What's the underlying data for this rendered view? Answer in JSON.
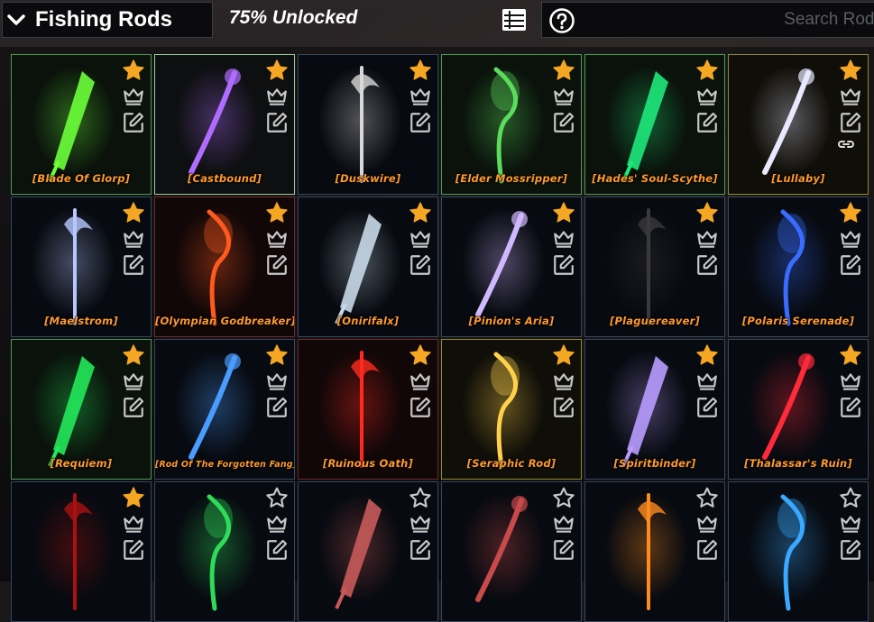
{
  "header": {
    "title": "Fishing Rods",
    "unlocked": "75% Unlocked",
    "search_placeholder": "Search Rods"
  },
  "colors": {
    "name_text": "#ff9a2e",
    "star_filled": "#f5a623",
    "icon_gray": "#c8c8c8"
  },
  "rods": [
    {
      "name": "[Blade Of Glorp]",
      "color": "#6cff3a",
      "favorited": true
    },
    {
      "name": "[Castbound]",
      "color": "#b06cff",
      "favorited": true
    },
    {
      "name": "[Duskwire]",
      "color": "#d8d8d8",
      "favorited": true
    },
    {
      "name": "[Elder Mossripper]",
      "color": "#5cdc5c",
      "favorited": true
    },
    {
      "name": "[Hades' Soul-Scythe]",
      "color": "#1ee87a",
      "favorited": true
    },
    {
      "name": "[Lullaby]",
      "color": "#e8e8ff",
      "favorited": true
    },
    {
      "name": "[Maelstrom]",
      "color": "#b8c8ff",
      "favorited": true
    },
    {
      "name": "[Olympian Godbreaker]",
      "color": "#ff5a1e",
      "favorited": true
    },
    {
      "name": "[Onirifalx]",
      "color": "#c8d8e8",
      "favorited": true
    },
    {
      "name": "[Pinion's Aria]",
      "color": "#d0b8ff",
      "favorited": true
    },
    {
      "name": "[Plaguereaver]",
      "color": "#3a3a3a",
      "favorited": true
    },
    {
      "name": "[Polaris Serenade]",
      "color": "#3a6cff",
      "favorited": true
    },
    {
      "name": "[Requiem]",
      "color": "#22e85a",
      "favorited": true
    },
    {
      "name": "[Rod Of The Forgotten Fang]",
      "color": "#4a9cff",
      "favorited": true
    },
    {
      "name": "[Ruinous Oath]",
      "color": "#ff2a1e",
      "favorited": true
    },
    {
      "name": "[Seraphic Rod]",
      "color": "#ffd04a",
      "favorited": true
    },
    {
      "name": "[Spiritbinder]",
      "color": "#b89cff",
      "favorited": true
    },
    {
      "name": "[Thalassar's Ruin]",
      "color": "#ff2a3a",
      "favorited": true
    },
    {
      "name": "",
      "color": "#aa1111",
      "favorited": true
    },
    {
      "name": "",
      "color": "#2edc5a",
      "favorited": false
    },
    {
      "name": "",
      "color": "#c85a5a",
      "favorited": false
    },
    {
      "name": "",
      "color": "#c84a4a",
      "favorited": false
    },
    {
      "name": "",
      "color": "#ff8a1e",
      "favorited": false
    },
    {
      "name": "",
      "color": "#3aa8ff",
      "favorited": false
    }
  ]
}
